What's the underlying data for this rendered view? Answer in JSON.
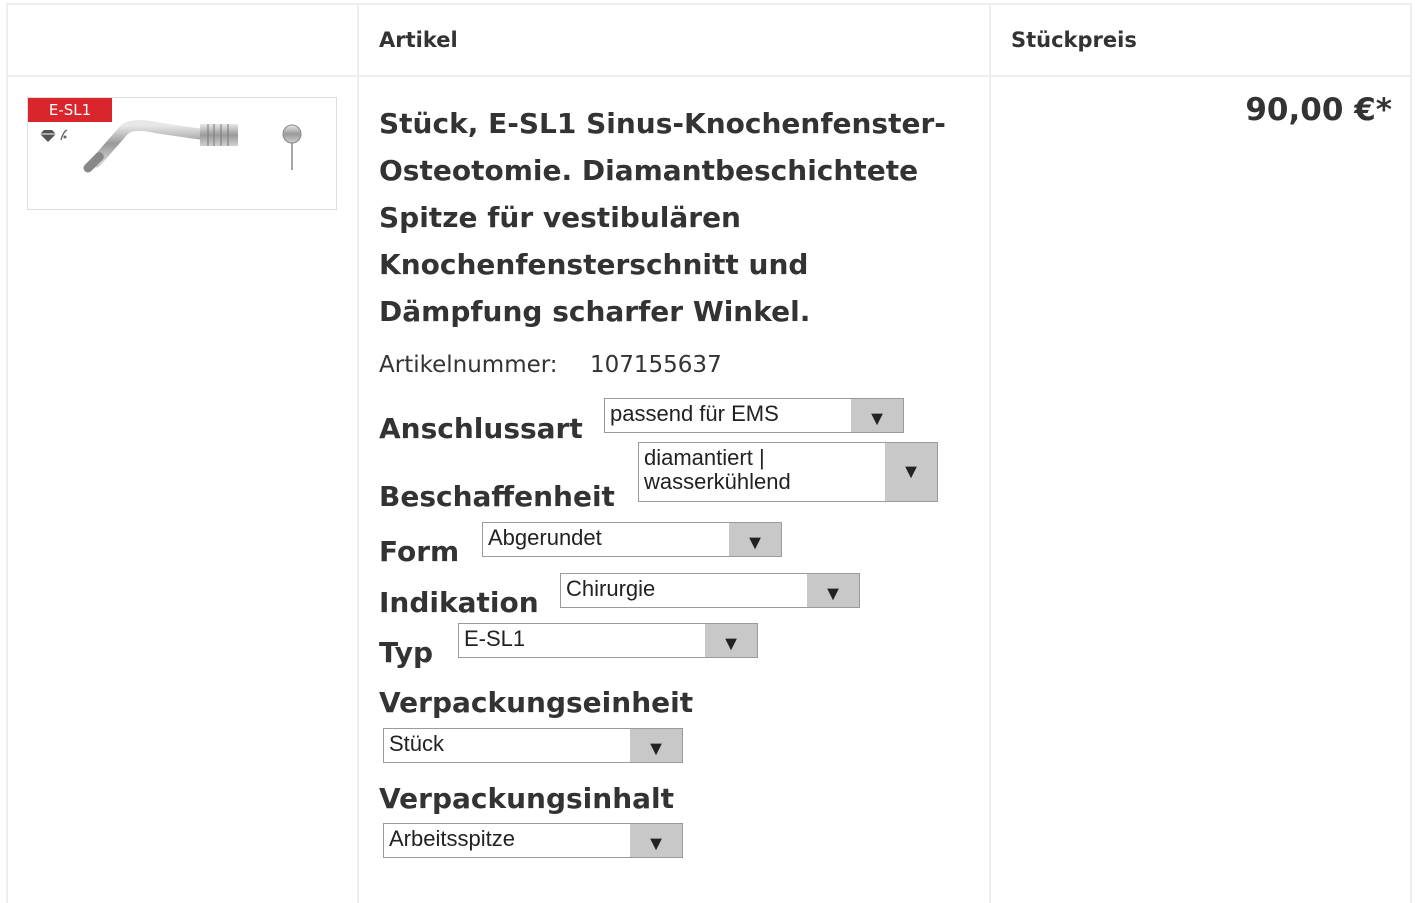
{
  "header": {
    "col_article": "Artikel",
    "col_price": "Stückpreis"
  },
  "product": {
    "image_badge": "E-SL1",
    "title": "Stück, E-SL1 Sinus-Knochenfenster-Osteotomie. Diamantbeschichtete Spitze für vestibulären Knochenfensterschnitt und Dämpfung scharfer Winkel.",
    "article_number_label": "Artikelnummer:",
    "article_number": "107155637",
    "price": "90,00 €*"
  },
  "options": {
    "anschlussart": {
      "label": "Anschlussart",
      "value": "passend für EMS"
    },
    "beschaffenheit": {
      "label": "Beschaffenheit",
      "value": "diamantiert | wasserkühlend"
    },
    "form": {
      "label": "Form",
      "value": "Abgerundet"
    },
    "indikation": {
      "label": "Indikation",
      "value": "Chirurgie"
    },
    "typ": {
      "label": "Typ",
      "value": "E-SL1"
    },
    "verpackungseinheit": {
      "label": "Verpackungseinheit",
      "value": "Stück"
    },
    "verpackungsinhalt": {
      "label": "Verpackungsinhalt",
      "value": "Arbeitsspitze"
    }
  },
  "icons": {
    "dropdown": "triangle-down-icon",
    "diamond": "diamond-icon",
    "water": "water-drop-icon"
  },
  "colors": {
    "badge": "#d9262c",
    "select_arrow_bg": "#c8c8c8",
    "grid": "#eeeeee"
  }
}
